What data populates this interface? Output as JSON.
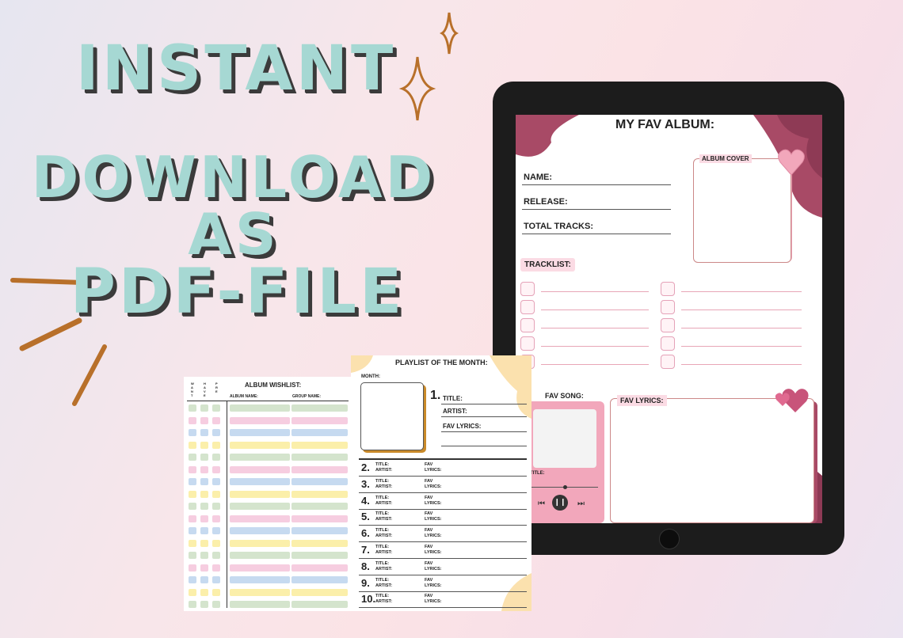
{
  "headline": {
    "line1": "INSTANT",
    "line2": "DOWNLOAD AS",
    "line3": "PDF-FILE"
  },
  "colors": {
    "mint": "#a6d8d3",
    "shadow": "#3b3b3b",
    "maroon": "#a84a66",
    "pink": "#f2a7bb",
    "pink_light": "#fbdbe4",
    "cream": "#fbe1ae",
    "brush": "#b8702a"
  },
  "tablet_page": {
    "title": "MY FAV ALBUM:",
    "fields": [
      "NAME:",
      "RELEASE:",
      "TOTAL TRACKS:"
    ],
    "album_cover_label": "ALBUM COVER",
    "tracklist_label": "TRACKLIST:",
    "fav_song_label": "FAV SONG:",
    "title_short": "TITLE:",
    "fav_lyrics_label": "FAV LYRICS:"
  },
  "playlist_page": {
    "title": "PLAYLIST OF THE MONTH:",
    "month_label": "MONTH:",
    "first_number": "1.",
    "first_fields": [
      "TITLE:",
      "ARTIST:",
      "FAV LYRICS:"
    ],
    "entries": [
      "2.",
      "3.",
      "4.",
      "5.",
      "6.",
      "7.",
      "8.",
      "9.",
      "10."
    ],
    "title_label": "TITLE:",
    "artist_label": "ARTIST:",
    "fav_label": "FAV",
    "lyrics_label": "LYRICS:"
  },
  "wishlist_page": {
    "title": "ALBUM WISHLIST:",
    "col_headers": [
      "WANT",
      "HAVE",
      "PRE"
    ],
    "album_name_label": "ALBUM NAME:",
    "group_name_label": "GROUP NAME:"
  }
}
